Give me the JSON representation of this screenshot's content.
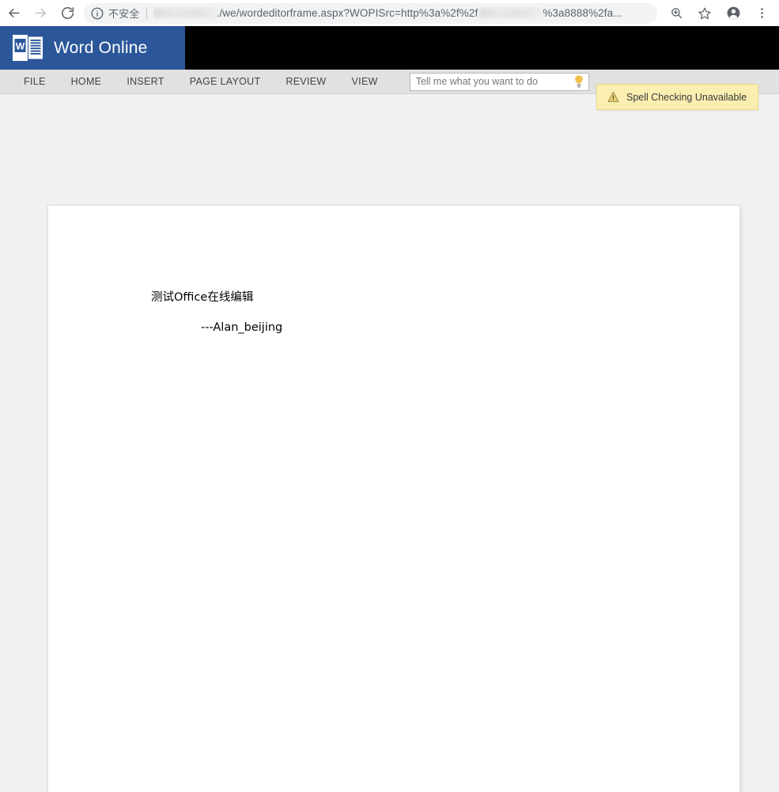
{
  "browser": {
    "back_label": "Back",
    "forward_label": "Forward",
    "reload_label": "Reload",
    "security_label": "不安全",
    "url_visible_part_1": "./we/wordeditorframe.aspx?WOPISrc=http%3a%2f%2f",
    "url_visible_part_2": "%3a8888%2fa...",
    "url_redacted_1": "",
    "url_redacted_2": "",
    "zoom_icon_label": "Zoom",
    "bookmark_icon_label": "Bookmark this page",
    "profile_icon_label": "Profile",
    "menu_icon_label": "Customize and control"
  },
  "app": {
    "title": "Word Online",
    "logo_letter": "W",
    "brand_color": "#2b579a"
  },
  "ribbon": {
    "tabs": [
      {
        "label": "FILE"
      },
      {
        "label": "HOME"
      },
      {
        "label": "INSERT"
      },
      {
        "label": "PAGE LAYOUT"
      },
      {
        "label": "REVIEW"
      },
      {
        "label": "VIEW"
      }
    ],
    "tell_me": {
      "placeholder": "Tell me what you want to do",
      "value": "",
      "icon": "lightbulb-icon"
    }
  },
  "notification": {
    "icon": "warning-triangle-icon",
    "text": "Spell Checking Unavailable",
    "background": "#faeeb1"
  },
  "document": {
    "paragraphs": [
      {
        "text": "测试Office在线编辑"
      },
      {
        "text": "---Alan_beijing"
      }
    ]
  }
}
